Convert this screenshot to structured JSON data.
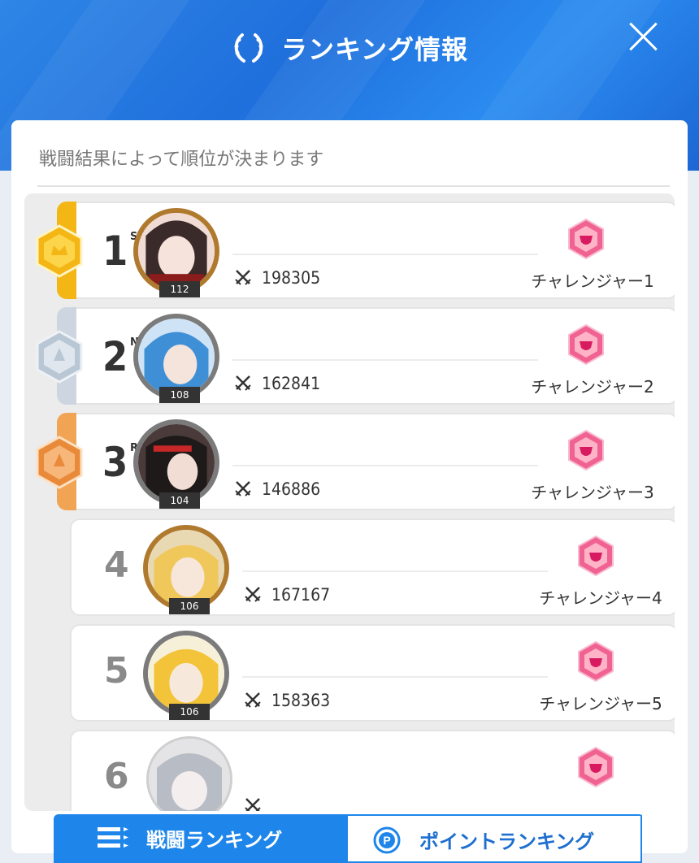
{
  "header": {
    "title": "ランキング情報",
    "icons": {
      "title_icon": "laurel-wreath-icon",
      "close": "close-icon"
    }
  },
  "panel": {
    "subtitle": "戦闘結果によって順位が決まります"
  },
  "colors": {
    "header_blue": "#2f86e6",
    "gold": "#f3b614",
    "silver": "#cdd6e0",
    "bronze": "#f0a454",
    "badge_pink": "#f06292"
  },
  "rows": [
    {
      "rank": "1",
      "suffix": "ST",
      "level": "112",
      "score": "198305",
      "tier": "チャレンジャー1",
      "medal": "gold"
    },
    {
      "rank": "2",
      "suffix": "ND",
      "level": "108",
      "score": "162841",
      "tier": "チャレンジャー2",
      "medal": "silver"
    },
    {
      "rank": "3",
      "suffix": "RD",
      "level": "104",
      "score": "146886",
      "tier": "チャレンジャー3",
      "medal": "bronze"
    },
    {
      "rank": "4",
      "level": "106",
      "score": "167167",
      "tier": "チャレンジャー4"
    },
    {
      "rank": "5",
      "level": "106",
      "score": "158363",
      "tier": "チャレンジャー5"
    },
    {
      "rank": "6",
      "level": "",
      "score": "",
      "tier": ""
    }
  ],
  "tabs": [
    {
      "label": "戦闘ランキング",
      "icon": "list-icon",
      "active": true
    },
    {
      "label": "ポイントランキング",
      "icon": "points-coin-icon",
      "active": false
    }
  ]
}
